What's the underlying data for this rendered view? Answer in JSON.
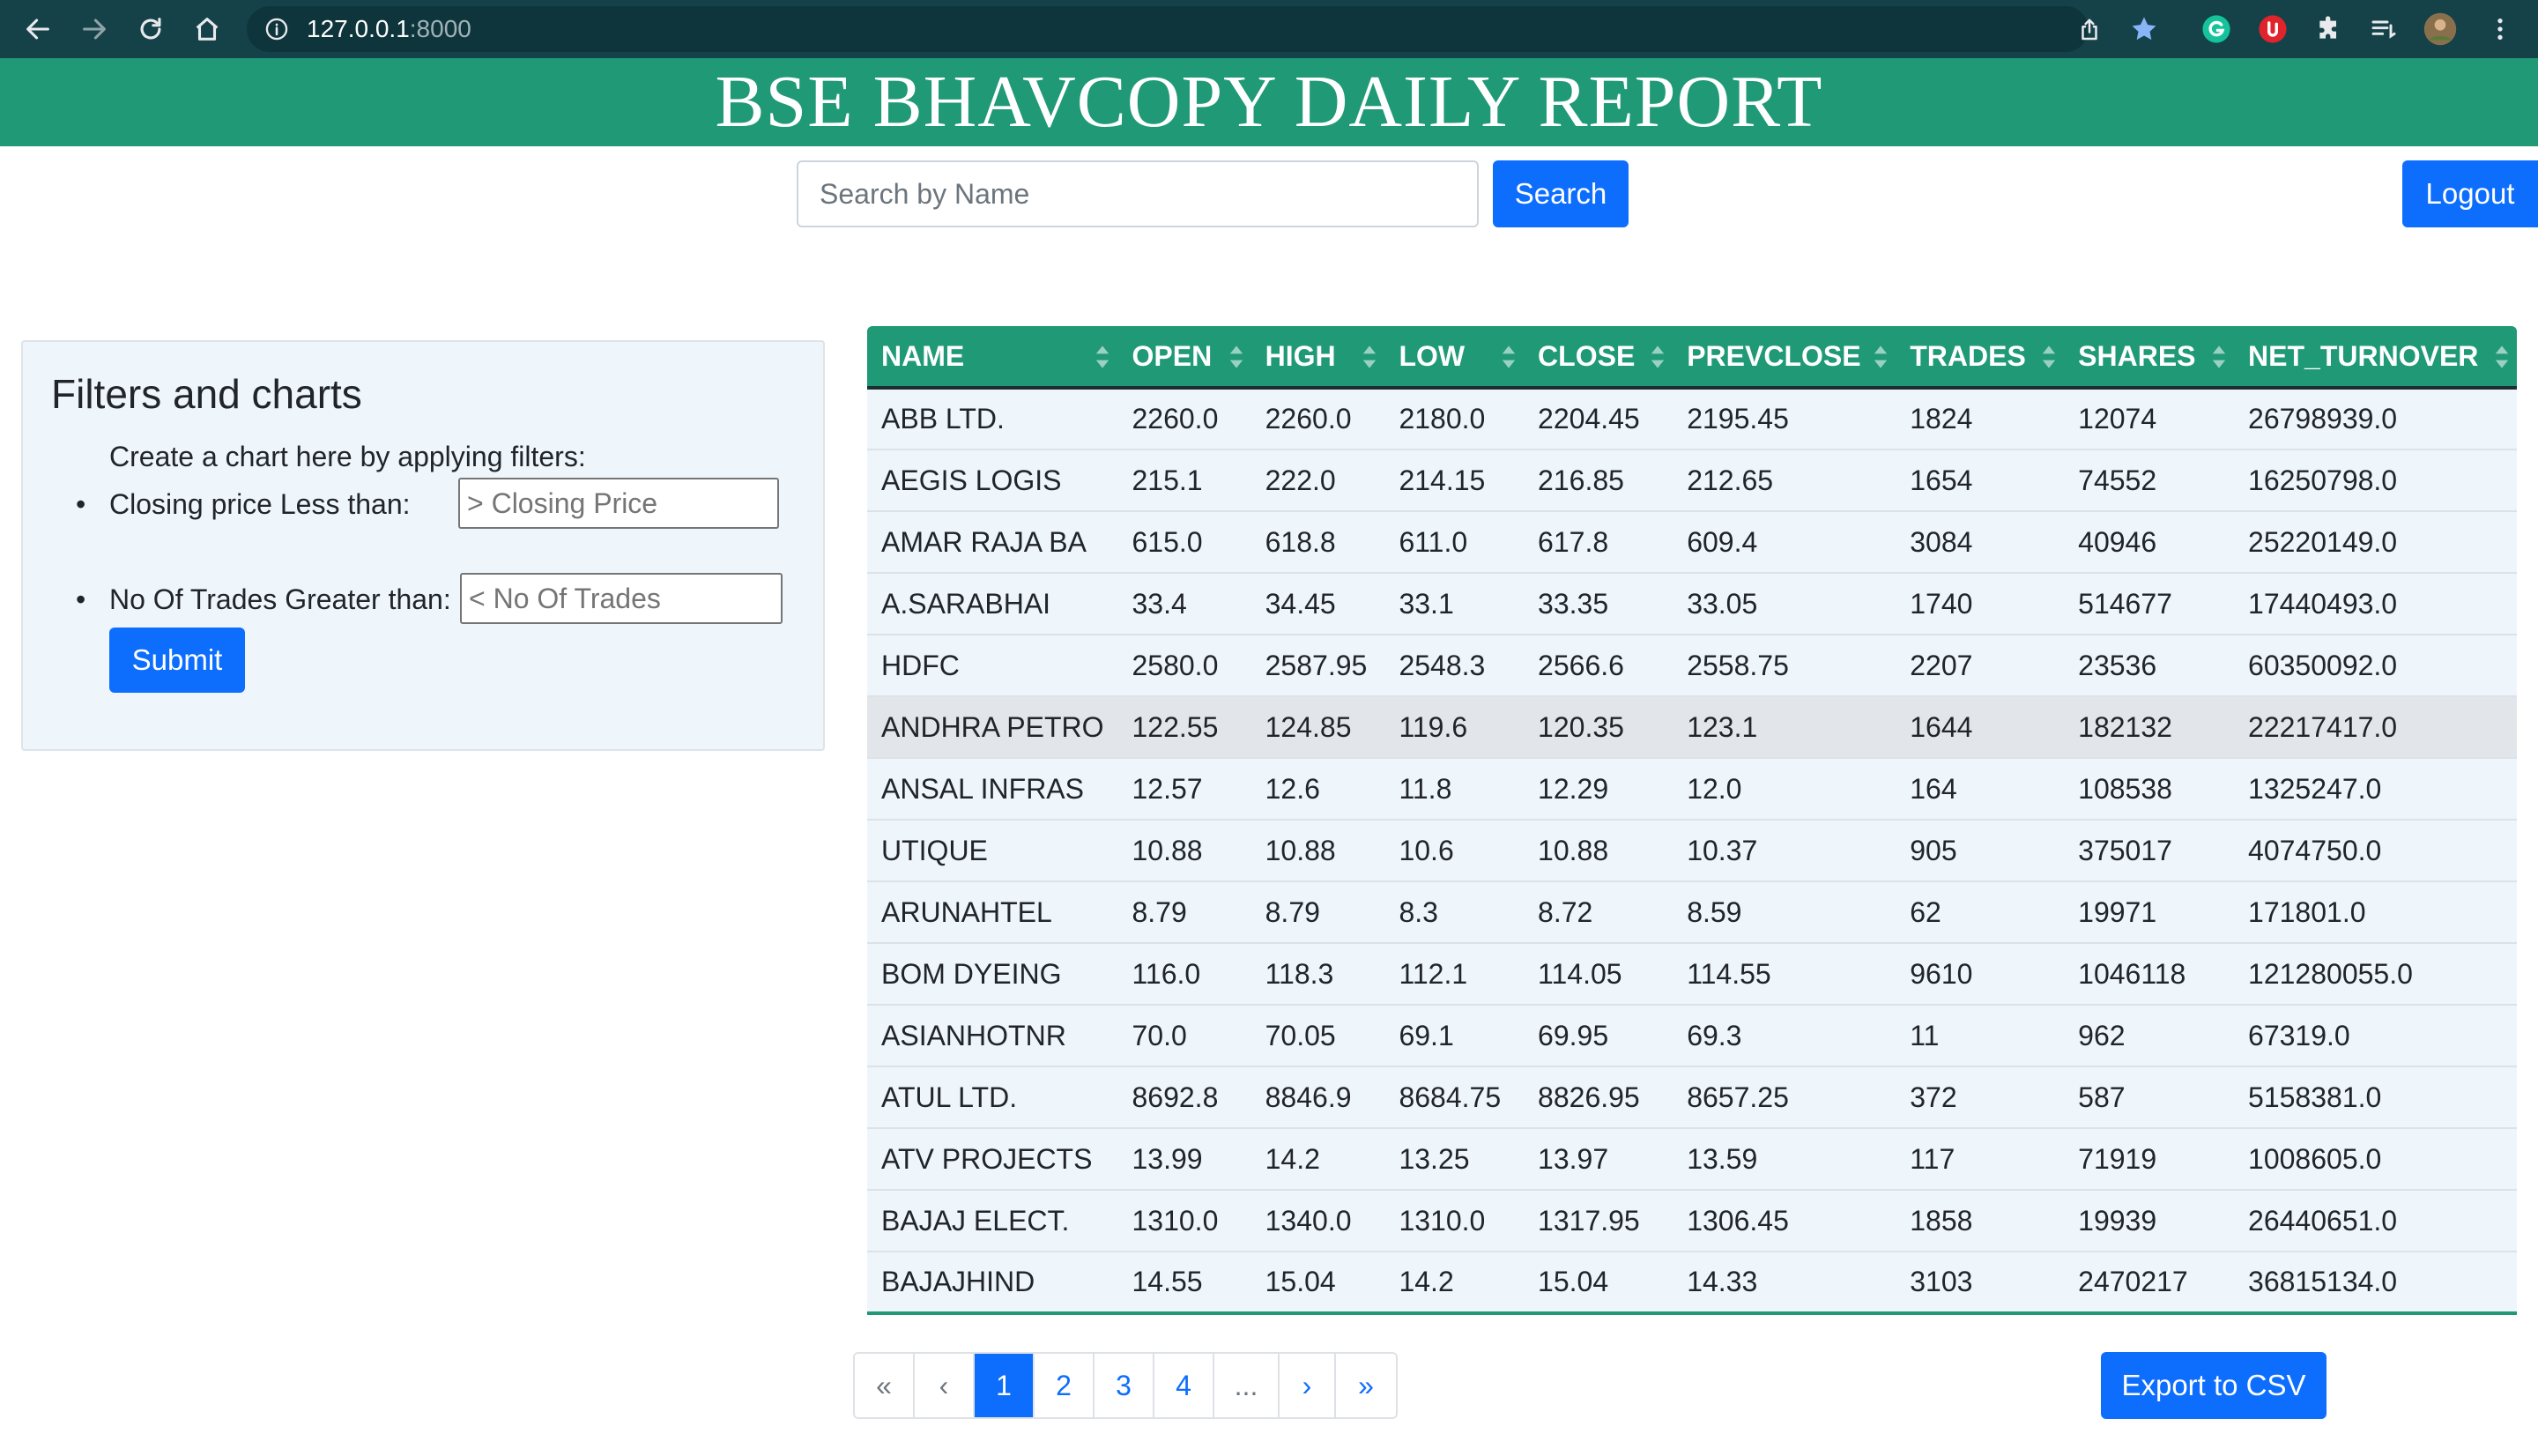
{
  "browser": {
    "url_host": "127.0.0.1",
    "url_port": ":8000"
  },
  "header": {
    "title": "BSE BHAVCOPY DAILY REPORT"
  },
  "search": {
    "placeholder": "Search by Name",
    "button_label": "Search",
    "logout_label": "Logout"
  },
  "filters": {
    "title": "Filters and charts",
    "intro": "Create a chart here by applying filters:",
    "closing_label": "Closing price Less than:",
    "closing_placeholder": "> Closing Price",
    "trades_label": "No Of Trades Greater than:",
    "trades_placeholder": "< No Of Trades",
    "submit_label": "Submit"
  },
  "table": {
    "columns": [
      "NAME",
      "OPEN",
      "HIGH",
      "LOW",
      "CLOSE",
      "PREVCLOSE",
      "TRADES",
      "SHARES",
      "NET_TURNOVER"
    ],
    "rows": [
      [
        "ABB LTD.",
        "2260.0",
        "2260.0",
        "2180.0",
        "2204.45",
        "2195.45",
        "1824",
        "12074",
        "26798939.0"
      ],
      [
        "AEGIS LOGIS",
        "215.1",
        "222.0",
        "214.15",
        "216.85",
        "212.65",
        "1654",
        "74552",
        "16250798.0"
      ],
      [
        "AMAR RAJA BA",
        "615.0",
        "618.8",
        "611.0",
        "617.8",
        "609.4",
        "3084",
        "40946",
        "25220149.0"
      ],
      [
        "A.SARABHAI",
        "33.4",
        "34.45",
        "33.1",
        "33.35",
        "33.05",
        "1740",
        "514677",
        "17440493.0"
      ],
      [
        "HDFC",
        "2580.0",
        "2587.95",
        "2548.3",
        "2566.6",
        "2558.75",
        "2207",
        "23536",
        "60350092.0"
      ],
      [
        "ANDHRA PETRO",
        "122.55",
        "124.85",
        "119.6",
        "120.35",
        "123.1",
        "1644",
        "182132",
        "22217417.0"
      ],
      [
        "ANSAL INFRAS",
        "12.57",
        "12.6",
        "11.8",
        "12.29",
        "12.0",
        "164",
        "108538",
        "1325247.0"
      ],
      [
        "UTIQUE",
        "10.88",
        "10.88",
        "10.6",
        "10.88",
        "10.37",
        "905",
        "375017",
        "4074750.0"
      ],
      [
        "ARUNAHTEL",
        "8.79",
        "8.79",
        "8.3",
        "8.72",
        "8.59",
        "62",
        "19971",
        "171801.0"
      ],
      [
        "BOM DYEING",
        "116.0",
        "118.3",
        "112.1",
        "114.05",
        "114.55",
        "9610",
        "1046118",
        "121280055.0"
      ],
      [
        "ASIANHOTNR",
        "70.0",
        "70.05",
        "69.1",
        "69.95",
        "69.3",
        "11",
        "962",
        "67319.0"
      ],
      [
        "ATUL LTD.",
        "8692.8",
        "8846.9",
        "8684.75",
        "8826.95",
        "8657.25",
        "372",
        "587",
        "5158381.0"
      ],
      [
        "ATV PROJECTS",
        "13.99",
        "14.2",
        "13.25",
        "13.97",
        "13.59",
        "117",
        "71919",
        "1008605.0"
      ],
      [
        "BAJAJ ELECT.",
        "1310.0",
        "1340.0",
        "1310.0",
        "1317.95",
        "1306.45",
        "1858",
        "19939",
        "26440651.0"
      ],
      [
        "BAJAJHIND",
        "14.55",
        "15.04",
        "14.2",
        "15.04",
        "14.33",
        "3103",
        "2470217",
        "36815134.0"
      ]
    ],
    "hovered_row": 5
  },
  "pagination": {
    "first": "«",
    "prev": "‹",
    "pages": [
      "1",
      "2",
      "3",
      "4"
    ],
    "ellipsis": "...",
    "next": "›",
    "last": "»",
    "active_page": "1"
  },
  "export": {
    "label": "Export to CSV"
  },
  "colors": {
    "banner": "#1f9976",
    "primary": "#0d6efd",
    "chrome": "#154149"
  },
  "icons": {
    "toolbar": [
      "back-arrow-icon",
      "forward-arrow-icon",
      "reload-icon",
      "home-icon"
    ],
    "omnibox": [
      "info-icon",
      "share-icon",
      "bookmark-star-icon"
    ],
    "extensions": [
      "grammarly-icon",
      "extension-red-icon",
      "puzzle-extensions-icon",
      "reading-list-icon",
      "profile-avatar-icon",
      "kebab-menu-icon"
    ]
  }
}
